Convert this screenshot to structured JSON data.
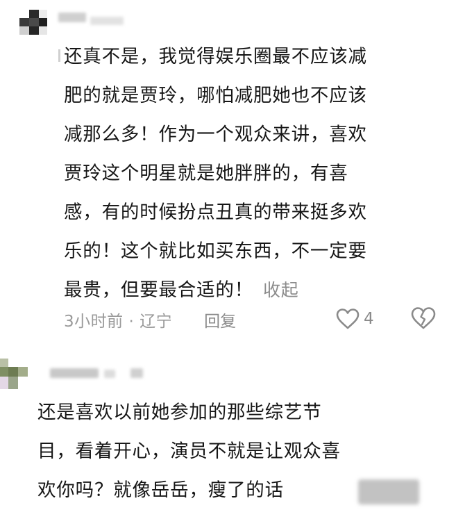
{
  "comments": [
    {
      "text_lines": [
        "还真不是，我觉得娱乐圈最不应该减",
        "肥的就是贾玲，哪怕减肥她也不应该",
        "减那么多！作为一个观众来讲，喜欢",
        "贾玲这个明星就是她胖胖的，有喜",
        "感，有的时候扮点丑真的带来挺多欢",
        "乐的！这个就比如买东西，不一定要",
        "最贵，但要最合适的！"
      ],
      "collapse_label": "收起",
      "time_location": "3小时前 · 辽宁",
      "reply_label": "回复",
      "like_count": "4",
      "icons": {
        "like": "heart-outline-icon",
        "dislike": "broken-heart-icon"
      }
    },
    {
      "text_lines": [
        "还是喜欢以前她参加的那些综艺节",
        "目，看着开心，演员不就是让观众喜",
        "欢你吗？就像岳岳，瘦了的话"
      ]
    }
  ],
  "colors": {
    "text": "#161616",
    "muted": "#9a9a9a",
    "icon": "#8a8a8a"
  }
}
